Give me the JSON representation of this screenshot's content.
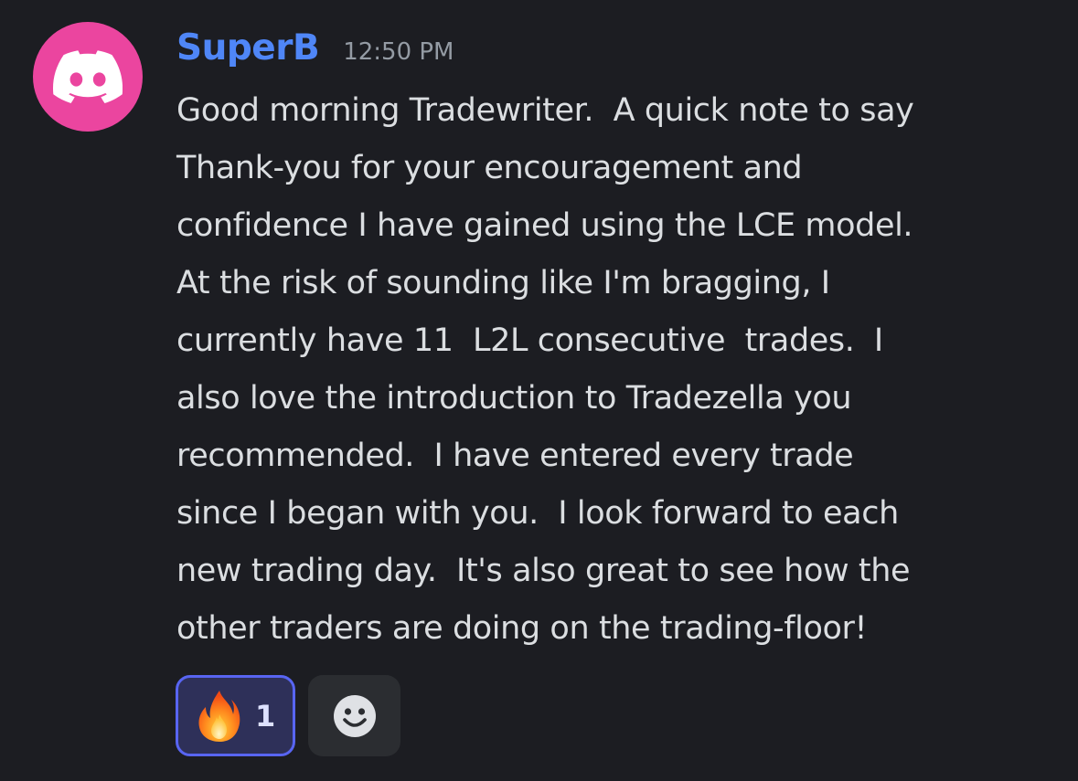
{
  "message": {
    "avatar_icon": "discord-logo-icon",
    "avatar_color": "#eb459f",
    "username": "SuperB",
    "username_color": "#4f86f7",
    "timestamp": "12:50 PM",
    "lines": [
      "Good morning Tradewriter.  A quick note to say",
      "Thank-you for your encouragement and",
      "confidence I have gained using the LCE model.",
      "At the risk of sounding like I'm bragging, I",
      "currently have 11  L2L consecutive  trades.  I",
      "also love the introduction to Tradezella you",
      "recommended.  I have entered every trade",
      "since I began with you.  I look forward to each",
      "new trading day.  It's also great to see how the",
      "other traders are doing on the trading-floor!"
    ]
  },
  "reactions": [
    {
      "emoji": "fire-icon",
      "count": "1",
      "active": true
    }
  ],
  "add_reaction_icon": "smiley-face-icon"
}
